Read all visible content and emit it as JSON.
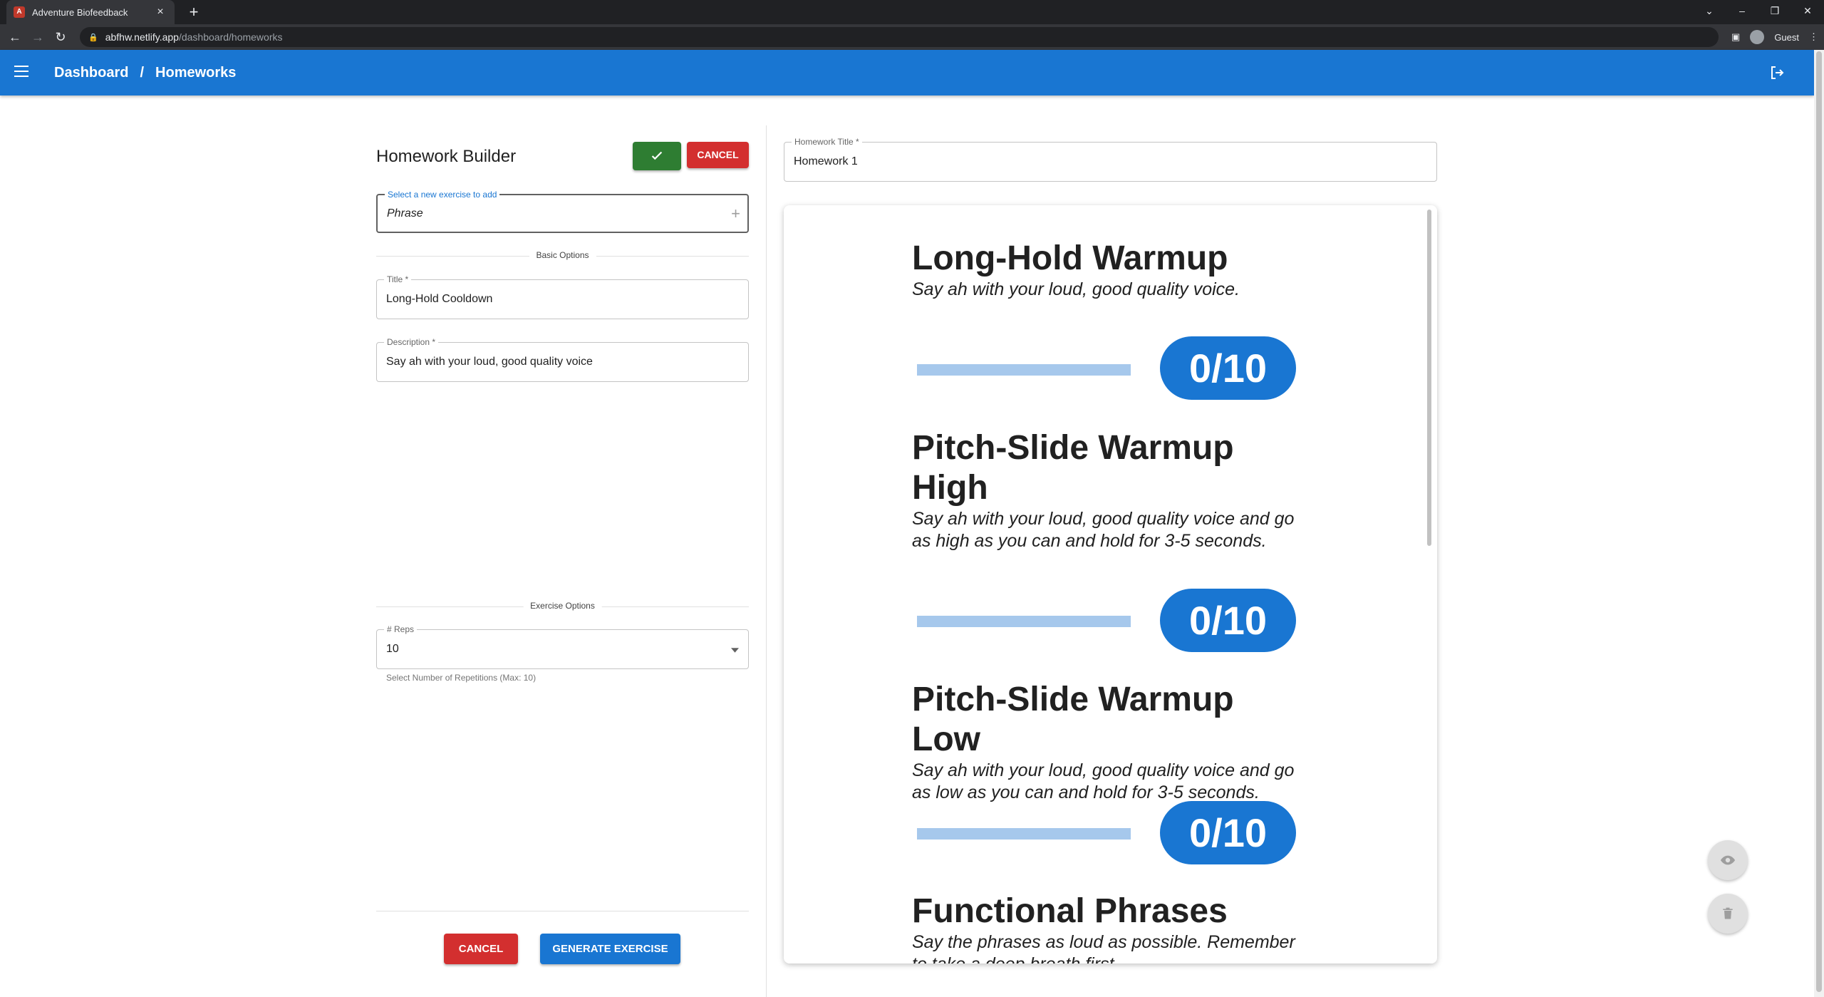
{
  "browser": {
    "tab_title": "Adventure Biofeedback",
    "url_host": "abfhw.netlify.app",
    "url_path": "/dashboard/homeworks",
    "profile": "Guest"
  },
  "appbar": {
    "crumb_dashboard": "Dashboard",
    "crumb_sep": "/",
    "crumb_homeworks": "Homeworks"
  },
  "builder": {
    "title": "Homework Builder",
    "cancel_top": "CANCEL",
    "exercise_select_label": "Select a new exercise to add",
    "exercise_select_value": "Phrase",
    "basic_options": "Basic Options",
    "title_label": "Title *",
    "title_value": "Long-Hold Cooldown",
    "description_label": "Description *",
    "description_value": "Say ah with your loud, good quality voice",
    "exercise_options": "Exercise Options",
    "reps_label": "# Reps",
    "reps_value": "10",
    "reps_helper": "Select Number of Repetitions (Max: 10)",
    "cancel_bottom": "CANCEL",
    "generate": "GENERATE EXERCISE"
  },
  "homework": {
    "title_label": "Homework Title *",
    "title_value": "Homework 1"
  },
  "preview": {
    "exercises": [
      {
        "title": "Long-Hold Warmup",
        "description": "Say ah with your loud, good quality voice.",
        "progress": "0/10"
      },
      {
        "title": "Pitch-Slide Warmup High",
        "description": "Say ah with your loud, good quality voice and go as high as you can and hold for 3-5 seconds.",
        "progress": "0/10"
      },
      {
        "title": "Pitch-Slide Warmup Low",
        "description": "Say ah with your loud, good quality voice and go as low as you can and hold for 3-5 seconds.",
        "progress": "0/10"
      },
      {
        "title": "Functional Phrases",
        "description": "Say the phrases as loud as possible. Remember to take a deep breath first."
      }
    ]
  },
  "colors": {
    "primary": "#1976d2",
    "success": "#2e7d32",
    "danger": "#d32f2f",
    "bar_light": "#a6c8ec"
  }
}
